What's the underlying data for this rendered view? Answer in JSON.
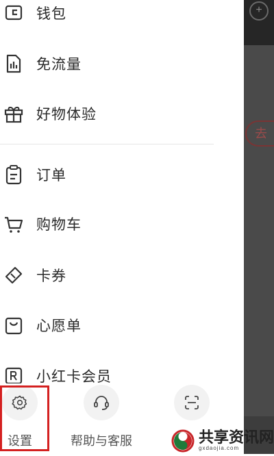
{
  "menu": {
    "items": [
      {
        "label": "钱包",
        "icon": "wallet-icon"
      },
      {
        "label": "免流量",
        "icon": "data-chart-icon"
      },
      {
        "label": "好物体验",
        "icon": "gift-icon"
      },
      {
        "label": "订单",
        "icon": "order-clipboard-icon"
      },
      {
        "label": "购物车",
        "icon": "cart-icon"
      },
      {
        "label": "卡券",
        "icon": "coupon-tag-icon"
      },
      {
        "label": "心愿单",
        "icon": "wishlist-bag-icon"
      },
      {
        "label": "小红卡会员",
        "icon": "membership-card-icon"
      }
    ]
  },
  "bottom_bar": {
    "settings_label": "设置",
    "help_label": "帮助与客服",
    "scan_icon": "scan-icon"
  },
  "backdrop": {
    "plus_label": "+",
    "go_label": "去"
  },
  "watermark": {
    "main": "共享资讯网",
    "sub": "gxdaojia.com"
  },
  "colors": {
    "highlight": "#d42020",
    "backdrop": "#4a4a4a",
    "text": "#2a2a2a"
  }
}
